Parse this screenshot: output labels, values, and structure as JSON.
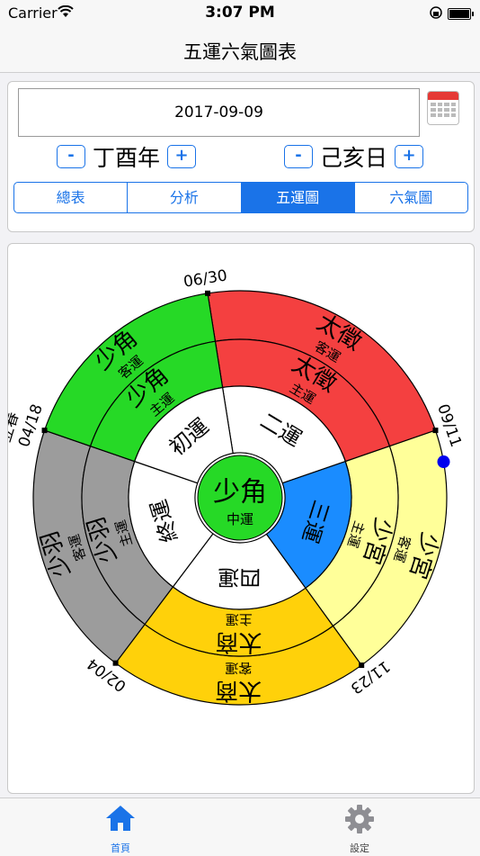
{
  "status": {
    "carrier": "Carrier",
    "time": "3:07 PM"
  },
  "nav": {
    "title": "五運六氣圖表"
  },
  "date": {
    "value": "2017-09-09"
  },
  "year": {
    "label": "丁酉年",
    "minus": "-",
    "plus": "+"
  },
  "day": {
    "label": "己亥日",
    "minus": "-",
    "plus": "+"
  },
  "segments": [
    "總表",
    "分析",
    "五運圖",
    "六氣圖"
  ],
  "wheel": {
    "center": {
      "main": "少角",
      "sub": "中運"
    },
    "dates": [
      "06/30",
      "09/11",
      "11/23",
      "02/04",
      "04/18"
    ],
    "solar_term": "立春",
    "sectors": [
      {
        "guest": "太徵",
        "guest_label": "客運",
        "host": "太徵",
        "host_label": "主運",
        "inner": "二運",
        "color": "#f44040"
      },
      {
        "guest": "少宮",
        "guest_label": "客運",
        "host": "少宮",
        "host_label": "主運",
        "inner": "三運",
        "color": "#ffff99"
      },
      {
        "guest": "太商",
        "guest_label": "客運",
        "host": "太商",
        "host_label": "主運",
        "inner": "四運",
        "color": "#ffd10a"
      },
      {
        "guest": "少羽",
        "guest_label": "客運",
        "host": "少羽",
        "host_label": "主運",
        "inner": "終運",
        "color": "#9c9c9c"
      },
      {
        "guest": "少角",
        "guest_label": "客運",
        "host": "少角",
        "host_label": "主運",
        "inner": "初運",
        "color": "#26d926"
      }
    ],
    "highlight_color": "#1a8cff"
  },
  "tabs": [
    {
      "label": "首頁"
    },
    {
      "label": "設定"
    }
  ]
}
